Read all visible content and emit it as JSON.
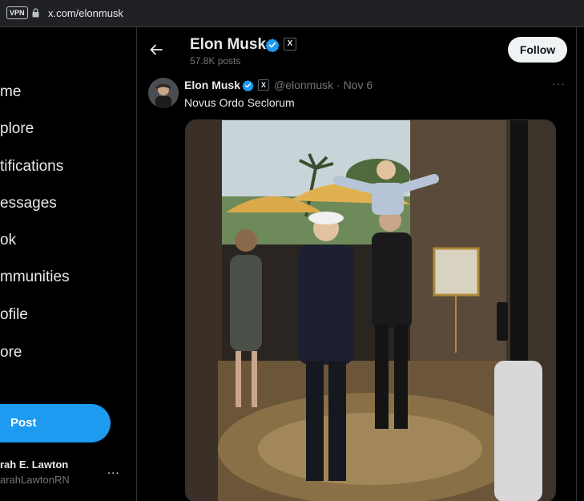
{
  "browser": {
    "vpn_label": "VPN",
    "url": "x.com/elonmusk"
  },
  "sidebar": {
    "items": [
      {
        "label": "me",
        "icon": "home-icon"
      },
      {
        "label": "plore",
        "icon": "explore-icon"
      },
      {
        "label": "tifications",
        "icon": "notifications-icon"
      },
      {
        "label": "essages",
        "icon": "messages-icon"
      },
      {
        "label": "ok",
        "icon": "grok-icon"
      },
      {
        "label": "mmunities",
        "icon": "communities-icon"
      },
      {
        "label": "ofile",
        "icon": "profile-icon"
      },
      {
        "label": "ore",
        "icon": "more-icon"
      }
    ],
    "post_label": "Post",
    "account": {
      "name": "rah E. Lawton",
      "handle": "arahLawtonRN",
      "more": "..."
    }
  },
  "profile_header": {
    "name": "Elon Musk",
    "posts_count": "57.8K posts",
    "follow_label": "Follow",
    "badge_letter": "X"
  },
  "tweet": {
    "author_name": "Elon Musk",
    "handle_and_date": "@elonmusk · Nov 6",
    "text": "Novus Ordo Seclorum",
    "more": "···"
  },
  "colors": {
    "accent": "#1d9bf0",
    "background": "#000000",
    "muted_text": "#71767b"
  }
}
